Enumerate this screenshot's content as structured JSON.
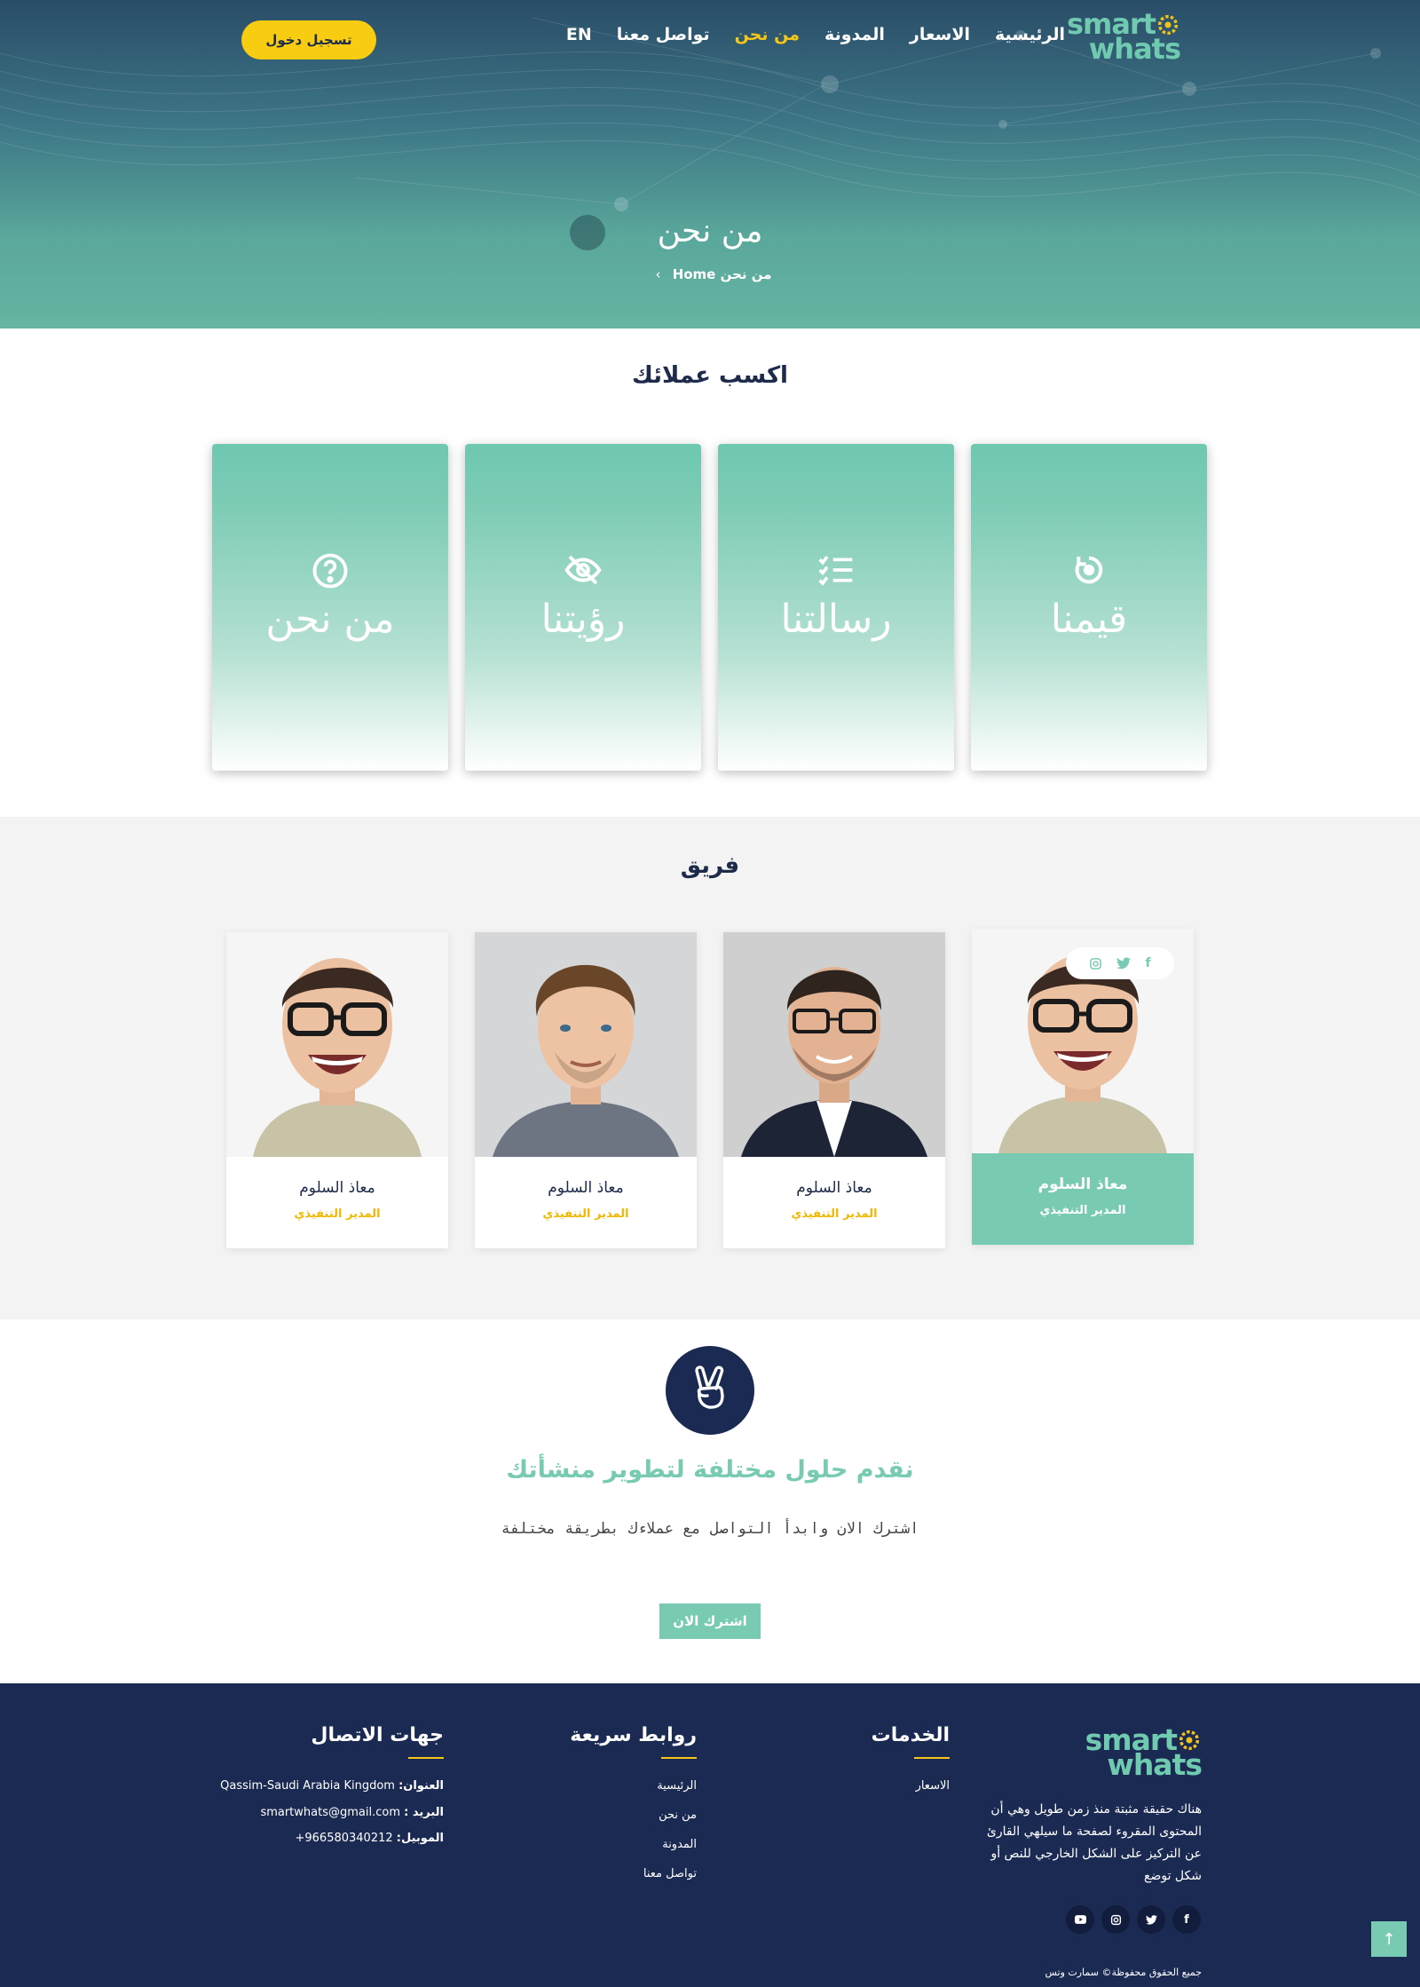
{
  "brand": {
    "logo_line1": "smart",
    "logo_line2": "whats",
    "accent": "#78cbb2",
    "yellow": "#f5c518",
    "navy": "#1b2a52"
  },
  "header": {
    "nav": [
      {
        "label": "الرئيسية",
        "active": false
      },
      {
        "label": "الاسعار",
        "active": false
      },
      {
        "label": "المدونة",
        "active": false
      },
      {
        "label": "من نحن",
        "active": true
      },
      {
        "label": "تواصل معنا",
        "active": false
      },
      {
        "label": "EN",
        "active": false
      }
    ],
    "login_label": "تسجيل دخول"
  },
  "hero": {
    "title": "من نحن",
    "breadcrumb_home": "Home",
    "breadcrumb_current": "من نحن"
  },
  "values": {
    "title": "اكسب عملائك",
    "cards": [
      {
        "label": "قيمنا",
        "icon": "refresh-icon"
      },
      {
        "label": "رسالتنا",
        "icon": "checklist-icon"
      },
      {
        "label": "رؤيتنا",
        "icon": "eye-slash-icon"
      },
      {
        "label": "من نحن",
        "icon": "question-icon"
      }
    ]
  },
  "team": {
    "title": "فريق",
    "members": [
      {
        "name": "معاذ السلوم",
        "role": "المدير التنفيذي"
      },
      {
        "name": "معاذ السلوم",
        "role": "المدير التنفيذي"
      },
      {
        "name": "معاذ السلوم",
        "role": "المدير التنفيذي"
      },
      {
        "name": "معاذ السلوم",
        "role": "المدير التنفيذي"
      }
    ],
    "social": [
      "facebook-icon",
      "twitter-icon",
      "instagram-icon"
    ]
  },
  "cta": {
    "title": "نقدم حلول مختلفة لتطوير منشأتك",
    "subtitle": "اشترك الان وابدأ التواصل مع عملاءك بطريقة مختلفة",
    "button": "اشترك الان"
  },
  "footer": {
    "about": "هناك حقيقة مثبتة منذ زمن طويل وهي أن المحتوى المقروء لصفحة ما سيلهي القارئ عن التركيز على الشكل الخارجي للنص أو شكل توضع",
    "services_title": "الخدمات",
    "services": [
      "الاسعار"
    ],
    "links_title": "روابط سريعة",
    "links": [
      "الرئيسية",
      "من نحن",
      "المدونة",
      "تواصل معنا"
    ],
    "contact_title": "جهات الاتصال",
    "address_label": "العنوان:",
    "address": "Qassim-Saudi Arabia Kingdom",
    "email_label": "البريد :",
    "email": "smartwhats@gmail.com",
    "phone_label": "الموبيل:",
    "phone": "+966580340212",
    "copyright": "جميع الحقوق محفوظة© سمارت وتس",
    "social": [
      "facebook-icon",
      "twitter-icon",
      "instagram-icon",
      "youtube-icon"
    ]
  }
}
